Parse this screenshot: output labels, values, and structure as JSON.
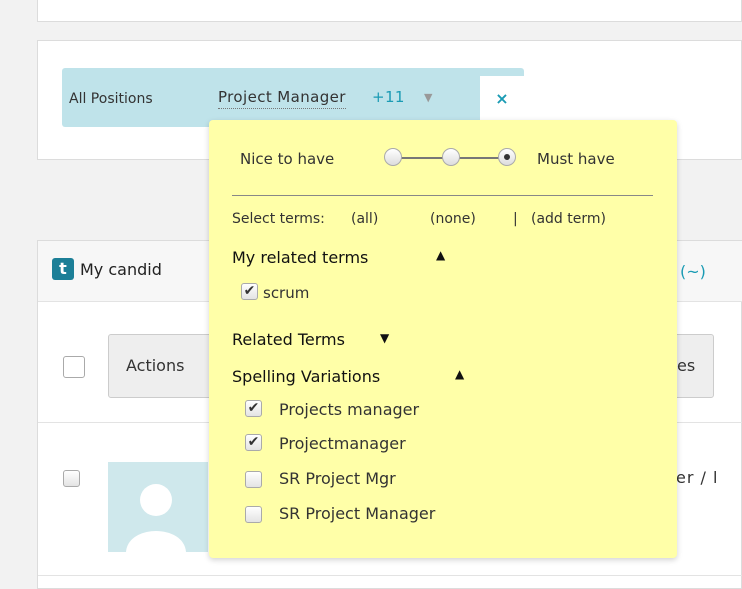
{
  "filter": {
    "label": "All Positions",
    "value": "Project Manager",
    "extra_count": "+11",
    "caret": "▼",
    "close": "×"
  },
  "popup": {
    "importance": {
      "left": "Nice to have",
      "right": "Must have",
      "selected_index": 2
    },
    "select_terms": {
      "label": "Select terms:",
      "all": "(all)",
      "none": "(none)",
      "sep": "|",
      "add": "(add term)"
    },
    "my_related": {
      "title": "My related terms",
      "caret": "▲",
      "items": [
        {
          "label": "scrum",
          "checked": true
        }
      ]
    },
    "related": {
      "title": "Related Terms",
      "caret": "▼"
    },
    "spelling": {
      "title": "Spelling Variations",
      "caret": "▲",
      "items": [
        {
          "label": "Projects manager",
          "checked": true
        },
        {
          "label": "Projectmanager",
          "checked": true
        },
        {
          "label": "SR Project Mgr",
          "checked": false
        },
        {
          "label": "SR Project Manager",
          "checked": false
        }
      ]
    }
  },
  "list": {
    "badge": "t",
    "title_partial": "My candid",
    "header_right": "(~)",
    "actions_partial": "Actions",
    "right_button_partial": "es",
    "row_text_partial": "er / l",
    "check_mark": "✔"
  }
}
